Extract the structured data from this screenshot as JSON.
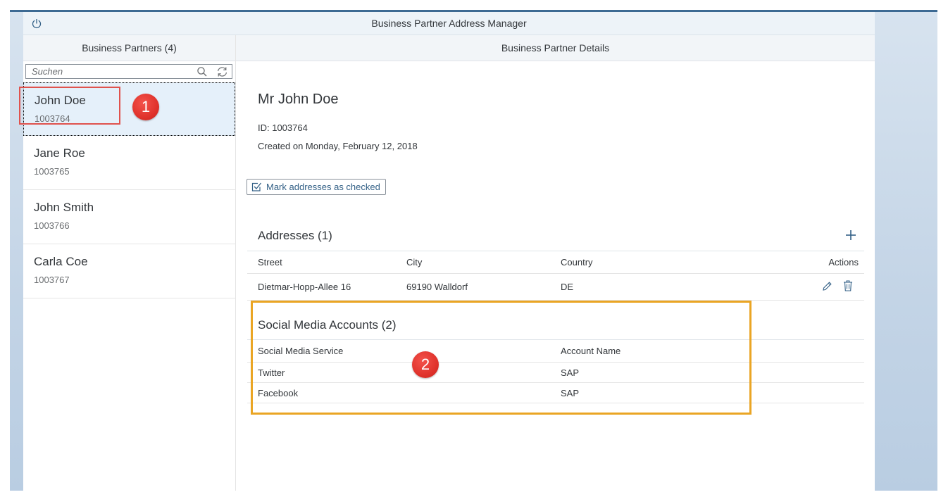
{
  "shell": {
    "title": "Business Partner Address Manager",
    "power_icon": "power-icon"
  },
  "master": {
    "header": "Business Partners (4)",
    "search": {
      "placeholder": "Suchen",
      "value": ""
    },
    "partners": [
      {
        "name": "John Doe",
        "id": "1003764",
        "selected": true
      },
      {
        "name": "Jane Roe",
        "id": "1003765",
        "selected": false
      },
      {
        "name": "John Smith",
        "id": "1003766",
        "selected": false
      },
      {
        "name": "Carla Coe",
        "id": "1003767",
        "selected": false
      }
    ]
  },
  "detail": {
    "header": "Business Partner Details",
    "title": "Mr John Doe",
    "id_line": "ID: 1003764",
    "created_line": "Created on Monday, February 12, 2018",
    "mark_button": "Mark addresses as checked",
    "addresses": {
      "title": "Addresses (1)",
      "columns": [
        "Street",
        "City",
        "Country",
        "Actions"
      ],
      "rows": [
        {
          "street": "Dietmar-Hopp-Allee 16",
          "city": "69190 Walldorf",
          "country": "DE"
        }
      ]
    },
    "social": {
      "title": "Social Media Accounts (2)",
      "columns": [
        "Social Media Service",
        "Account Name"
      ],
      "rows": [
        {
          "service": "Twitter",
          "account": "SAP"
        },
        {
          "service": "Facebook",
          "account": "SAP"
        }
      ]
    }
  },
  "annotations": {
    "badge1": "1",
    "badge2": "2"
  },
  "colors": {
    "accent": "#346187",
    "selected_bg": "#e5f0fa",
    "callout_red": "#e0524d",
    "callout_orange": "#eaa524"
  }
}
